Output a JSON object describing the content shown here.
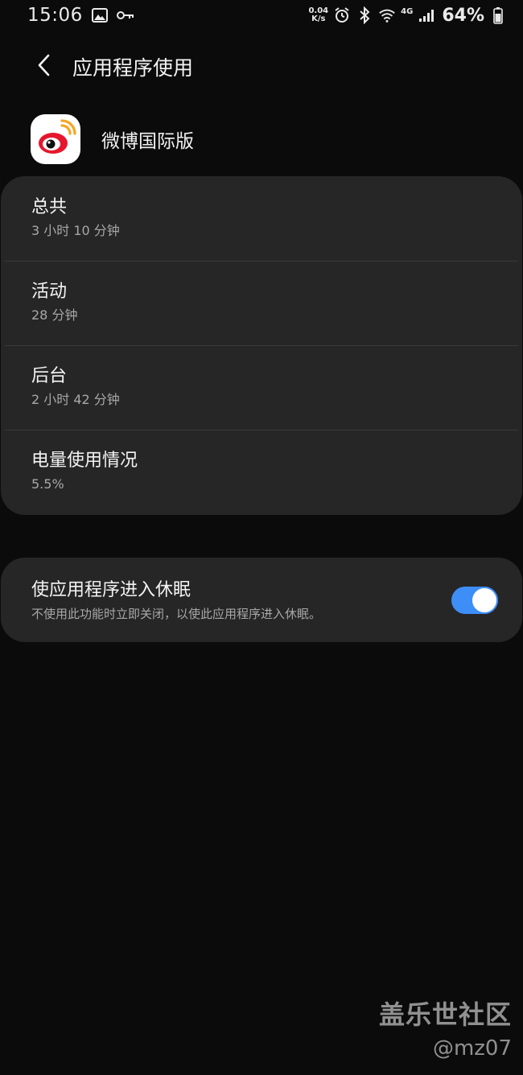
{
  "status_bar": {
    "time": "15:06",
    "net_speed_value": "0.04",
    "net_speed_unit": "K/s",
    "network_label": "4G",
    "battery_percent": "64%",
    "icons": [
      "image-icon",
      "key-icon",
      "alarm-icon",
      "bluetooth-icon",
      "wifi-icon",
      "signal-icon",
      "battery-icon"
    ]
  },
  "header": {
    "title": "应用程序使用",
    "back_icon": "chevron-left-icon"
  },
  "app": {
    "name": "微博国际版",
    "icon": "weibo-logo-icon"
  },
  "usage": {
    "items": [
      {
        "label": "总共",
        "value": "3 小时 10 分钟"
      },
      {
        "label": "活动",
        "value": "28 分钟"
      },
      {
        "label": "后台",
        "value": "2 小时 42 分钟"
      },
      {
        "label": "电量使用情况",
        "value": "5.5%"
      }
    ]
  },
  "sleep": {
    "title": "使应用程序进入休眠",
    "description": "不使用此功能时立即关闭，以使此应用程序进入休眠。",
    "toggle_on": true
  },
  "watermark": {
    "line1": "盖乐世社区",
    "line2": "@mz07"
  },
  "colors": {
    "background": "#0b0b0b",
    "card": "#262626",
    "accent": "#3e8ef7",
    "secondary_text": "#a8a8a8",
    "weibo_red": "#e6162d",
    "weibo_orange": "#f5a623"
  }
}
